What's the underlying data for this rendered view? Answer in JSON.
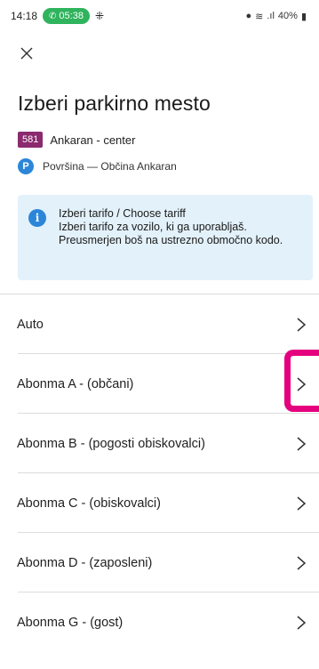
{
  "status_bar": {
    "time": "14:18",
    "call_duration": "05:38",
    "right_icons": "⚲ ≋ ᵛᵒˡᵗᵉ .ıl 40%▮",
    "battery": "40%"
  },
  "header": {
    "title": "Izberi parkirno mesto"
  },
  "zone": {
    "code": "581",
    "name": "Ankaran - center"
  },
  "parking": {
    "icon_letter": "P",
    "description": "Površina — Občina Ankaran"
  },
  "info": {
    "icon": "i",
    "line1": "Izberi tarifo / Choose tariff",
    "line2": "Izberi tarifo za vozilo, ki ga uporabljaš. Preusmerjen boš na ustrezno območno kodo."
  },
  "tariffs": [
    {
      "label": "Auto"
    },
    {
      "label": "Abonma A - (občani)"
    },
    {
      "label": "Abonma B - (pogosti obiskovalci)"
    },
    {
      "label": "Abonma C - (obiskovalci)"
    },
    {
      "label": "Abonma D - (zaposleni)"
    },
    {
      "label": "Abonma G - (gost)"
    }
  ],
  "colors": {
    "zone_badge": "#8b2a6e",
    "accent_blue": "#2c86d8",
    "info_bg": "#e3f1fb",
    "highlight": "#e5007e",
    "call_pill": "#2fb35c"
  }
}
